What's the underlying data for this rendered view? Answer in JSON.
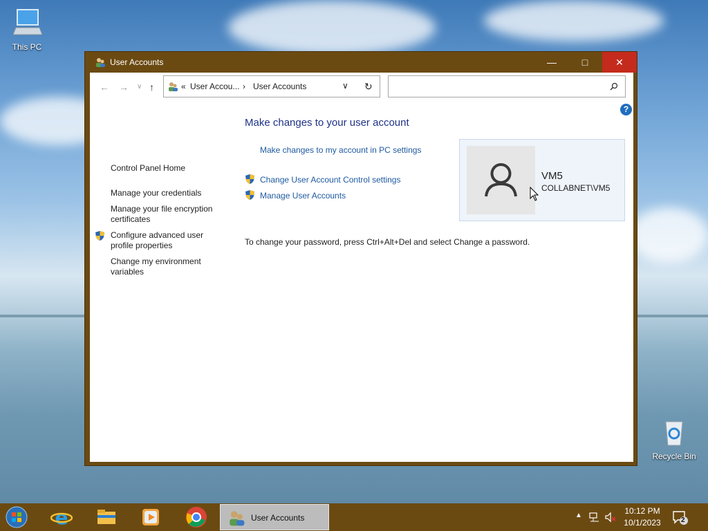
{
  "desktop": {
    "this_pc_label": "This PC",
    "recycle_bin_label": "Recycle Bin"
  },
  "window": {
    "title": "User Accounts",
    "breadcrumb_sep": "«",
    "breadcrumb": [
      "User Accou...",
      "User Accounts"
    ],
    "search_placeholder": ""
  },
  "left_pane": {
    "items": [
      "Control Panel Home",
      "Manage your credentials",
      "Manage your file encryption certificates",
      "Configure advanced user profile properties",
      "Change my environment variables"
    ]
  },
  "main": {
    "heading": "Make changes to your user account",
    "links": [
      "Make changes to my account in PC settings",
      "Change User Account Control settings",
      "Manage User Accounts"
    ],
    "info": "To change your password, press Ctrl+Alt+Del and select Change a password."
  },
  "user": {
    "name": "VM5",
    "domain": "COLLABNET\\VM5"
  },
  "taskbar": {
    "active_task": "User Accounts",
    "time": "10:12 PM",
    "date": "10/1/2023",
    "notification_count": "2"
  },
  "colors": {
    "frame": "#6b4a12",
    "link": "#1e5aa0",
    "heading": "#1e3287",
    "close": "#c42b1c"
  }
}
